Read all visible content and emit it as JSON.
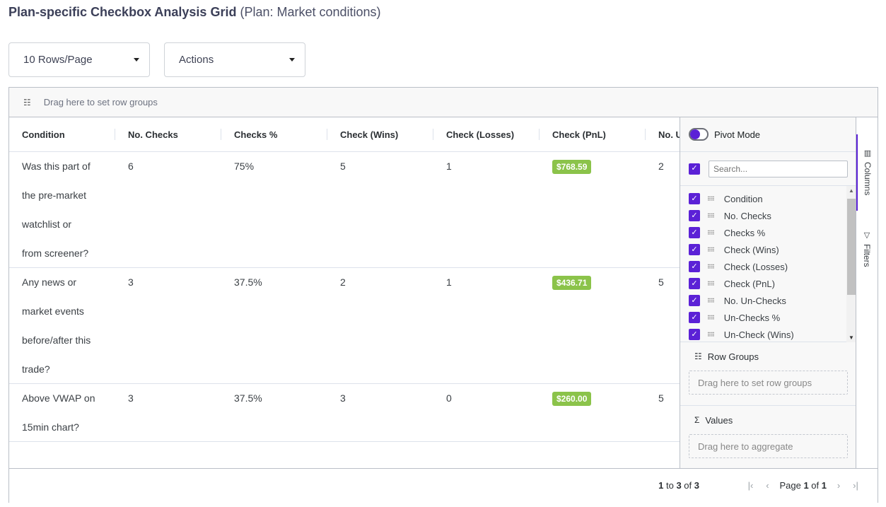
{
  "page": {
    "title_bold": "Plan-specific Checkbox Analysis Grid",
    "title_sub": "(Plan: Market conditions)"
  },
  "controls": {
    "rows_per_page": "10 Rows/Page",
    "actions": "Actions"
  },
  "grid": {
    "row_group_hint": "Drag here to set row groups",
    "columns": [
      "Condition",
      "No. Checks",
      "Checks %",
      "Check (Wins)",
      "Check (Losses)",
      "Check (PnL)",
      "No. U"
    ],
    "rows": [
      {
        "condition_lines": [
          "Was this part of",
          "the pre-market",
          "watchlist or",
          "from screener?"
        ],
        "no_checks": "6",
        "checks_pct": "75%",
        "wins": "5",
        "losses": "1",
        "pnl": "$768.59",
        "no_un": "2"
      },
      {
        "condition_lines": [
          "Any news or",
          "market events",
          "before/after this",
          "trade?"
        ],
        "no_checks": "3",
        "checks_pct": "37.5%",
        "wins": "2",
        "losses": "1",
        "pnl": "$436.71",
        "no_un": "5"
      },
      {
        "condition_lines": [
          "Above VWAP on",
          "15min chart?"
        ],
        "no_checks": "3",
        "checks_pct": "37.5%",
        "wins": "3",
        "losses": "0",
        "pnl": "$260.00",
        "no_un": "5"
      }
    ],
    "pnl_color": "#8bc34a",
    "footer": {
      "range_start": "1",
      "to": "to",
      "range_end": "3",
      "of": "of",
      "total": "3",
      "page_label": "Page",
      "page": "1",
      "page_of": "of",
      "page_total": "1"
    }
  },
  "tool_panel": {
    "pivot_mode": "Pivot Mode",
    "search_placeholder": "Search...",
    "column_items": [
      "Condition",
      "No. Checks",
      "Checks %",
      "Check (Wins)",
      "Check (Losses)",
      "Check (PnL)",
      "No. Un-Checks",
      "Un-Checks %",
      "Un-Check (Wins)"
    ],
    "row_groups_label": "Row Groups",
    "row_groups_hint": "Drag here to set row groups",
    "values_label": "Values",
    "values_hint": "Drag here to aggregate",
    "tabs": [
      "Columns",
      "Filters"
    ],
    "accent": "#5b21d6"
  }
}
